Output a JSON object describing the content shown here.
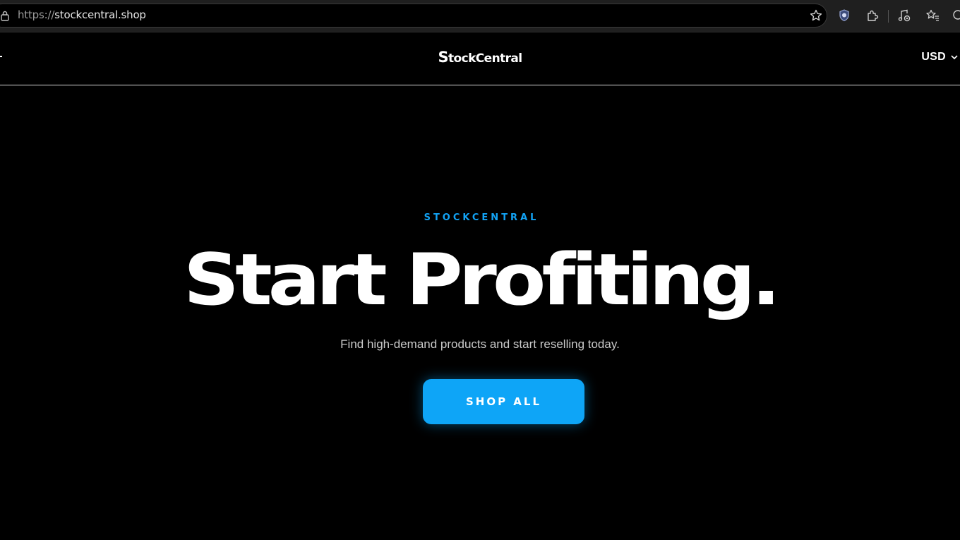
{
  "browser": {
    "url_scheme": "https://",
    "url_host": "stockcentral.shop",
    "icons": [
      "lock-icon",
      "star-icon",
      "shield-icon",
      "extensions-icon",
      "media-icon",
      "favorites-icon",
      "copilot-icon"
    ]
  },
  "header": {
    "logo_first": "S",
    "logo_rest": "tockCentral",
    "currency": "USD"
  },
  "hero": {
    "eyebrow": "STOCKCENTRAL",
    "headline": "Start Profiting.",
    "subtext": "Find high-demand products and start reselling today.",
    "cta_label": "SHOP ALL"
  },
  "colors": {
    "accent": "#0ea5f7",
    "background": "#000000",
    "text": "#ffffff"
  }
}
